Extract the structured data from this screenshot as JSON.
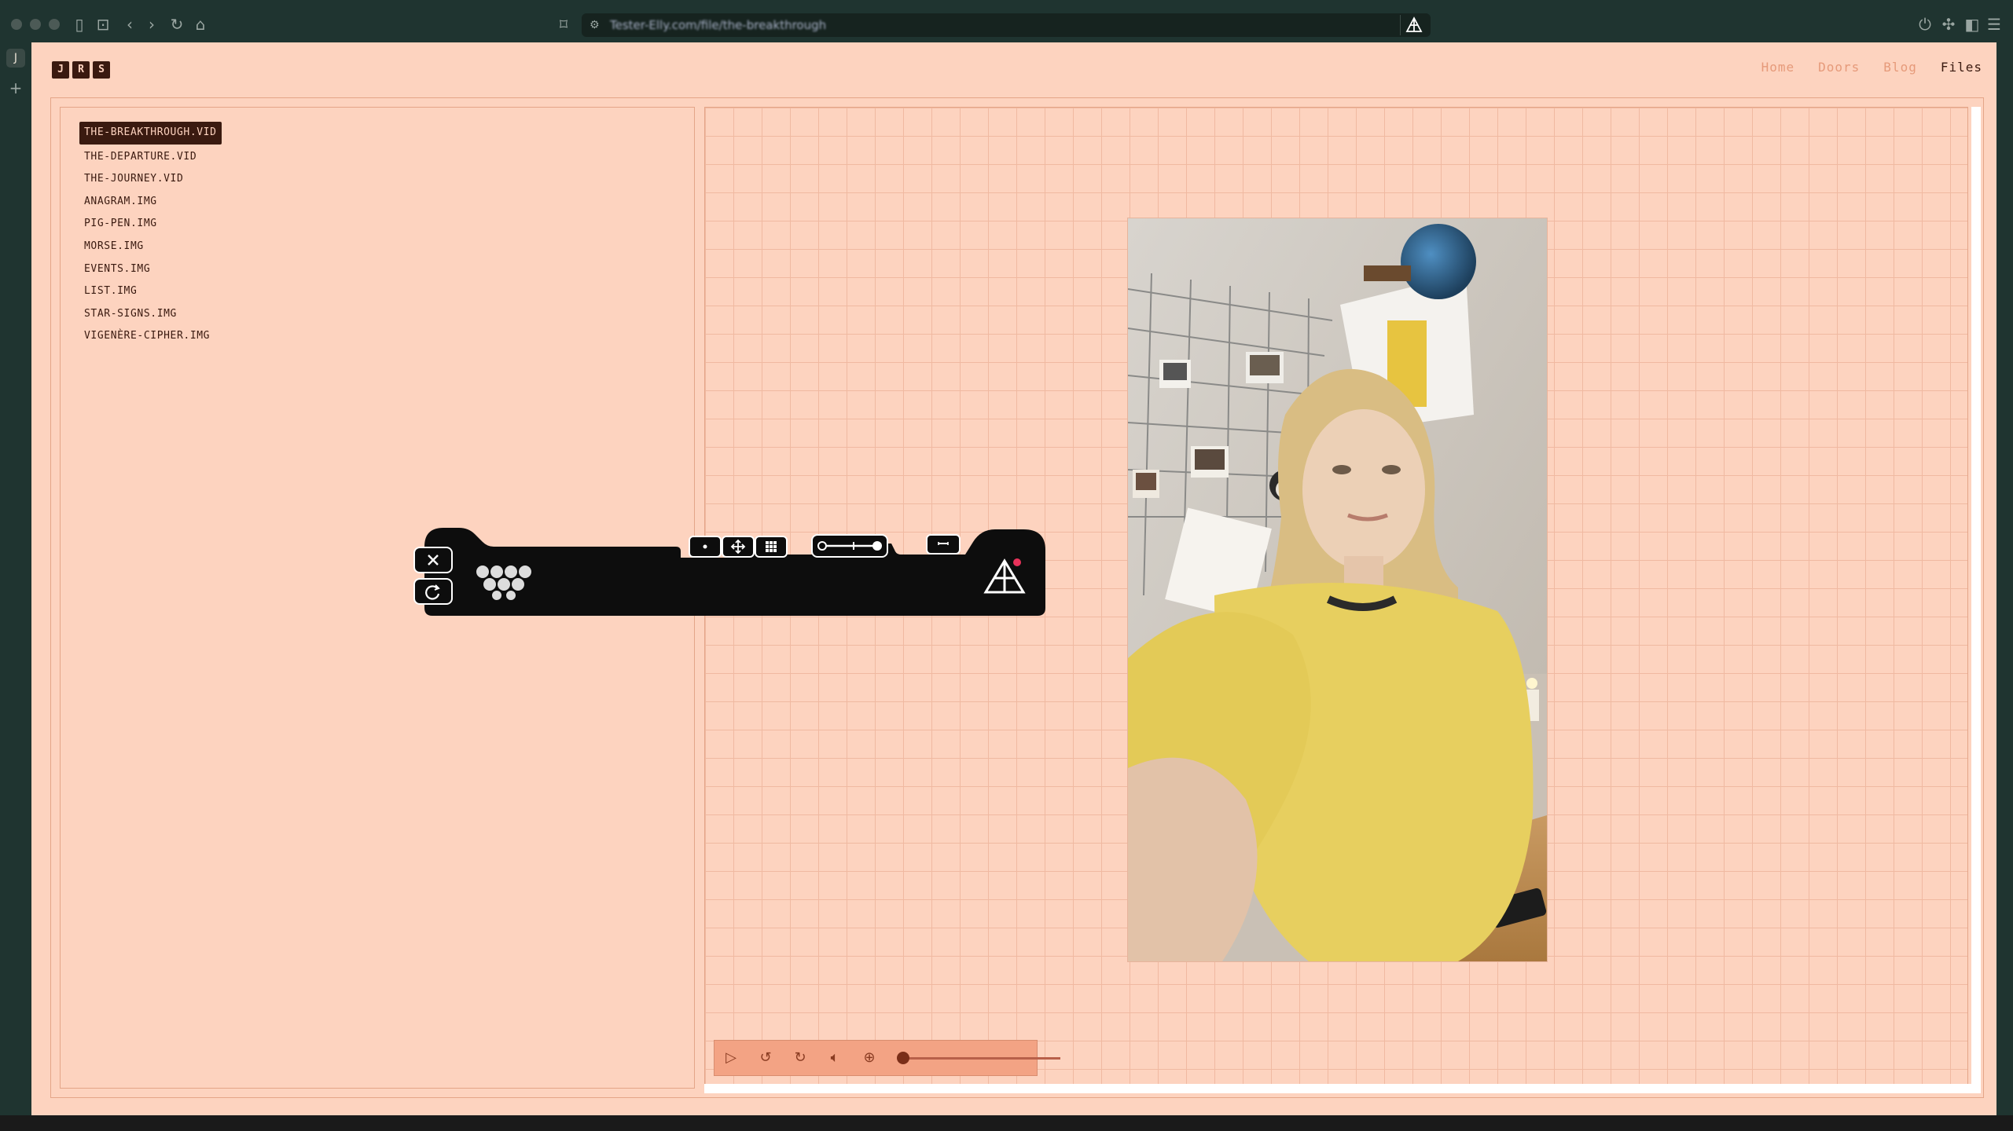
{
  "browser": {
    "url": "Tester-Elly.com/file/the-breakthrough",
    "sidebar_space_label": "J",
    "sidebar_add": "+"
  },
  "site": {
    "logo_letters": [
      "J",
      "R",
      "S"
    ],
    "nav": [
      {
        "label": "Home",
        "active": false
      },
      {
        "label": "Doors",
        "active": false
      },
      {
        "label": "Blog",
        "active": false
      },
      {
        "label": "Files",
        "active": true
      }
    ]
  },
  "files": [
    {
      "label": "THE-BREAKTHROUGH.VID",
      "active": true
    },
    {
      "label": "THE-DEPARTURE.VID",
      "active": false
    },
    {
      "label": "THE-JOURNEY.VID",
      "active": false
    },
    {
      "label": "ANAGRAM.IMG",
      "active": false
    },
    {
      "label": "PIG-PEN.IMG",
      "active": false
    },
    {
      "label": "MORSE.IMG",
      "active": false
    },
    {
      "label": "EVENTS.IMG",
      "active": false
    },
    {
      "label": "LIST.IMG",
      "active": false
    },
    {
      "label": "STAR-SIGNS.IMG",
      "active": false
    },
    {
      "label": "VIGENÈRE-CIPHER.IMG",
      "active": false
    }
  ],
  "player": {
    "controls": [
      "play-icon",
      "rewind-icon",
      "forward-icon",
      "volume-icon",
      "zoom-icon"
    ],
    "progress": 0.0
  },
  "widget": {
    "close_icon": "close-icon",
    "refresh_icon": "refresh-icon",
    "mode_icons": [
      "dot-icon",
      "move-icon",
      "grid-icon"
    ],
    "slider_icon": "slider-icon",
    "minimize_icon": "minimize-icon",
    "brand_icon": "triangle-logo-icon",
    "recording_indicator_color": "#e8325a"
  },
  "colors": {
    "page_bg": "#fdd3bf",
    "accent_dark": "#3a1a10",
    "nav_link": "#e69a7a",
    "grid_line": "#f0b9a1",
    "controls_bg": "#f3a384"
  }
}
